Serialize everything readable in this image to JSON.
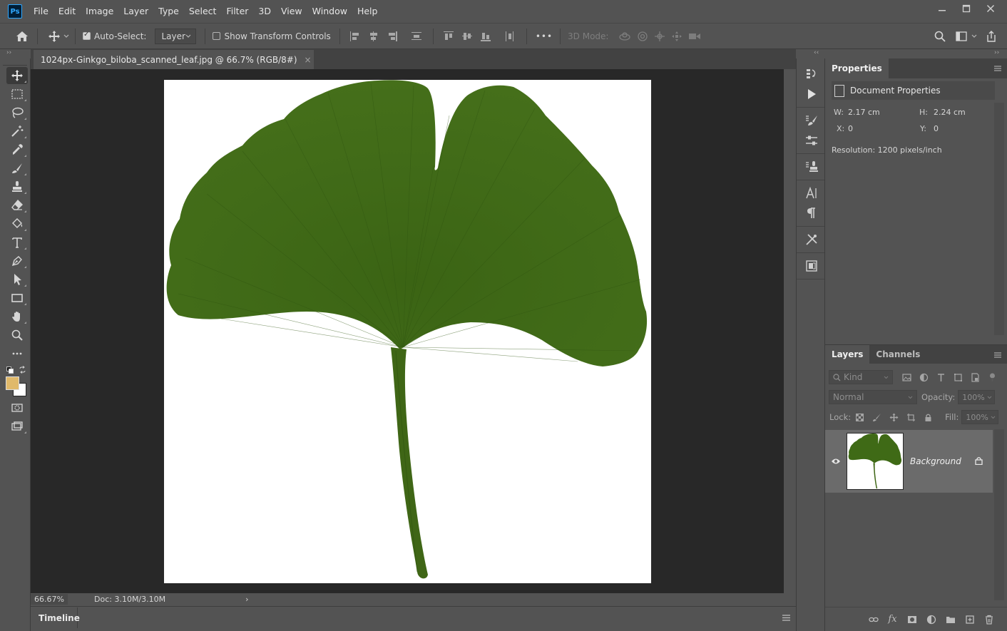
{
  "app": {
    "logo": "Ps"
  },
  "menu": [
    "File",
    "Edit",
    "Image",
    "Layer",
    "Type",
    "Select",
    "Filter",
    "3D",
    "View",
    "Window",
    "Help"
  ],
  "options": {
    "auto_select_label": "Auto-Select:",
    "auto_select_checked": true,
    "layer_select_value": "Layer",
    "show_transform_label": "Show Transform Controls",
    "show_transform_checked": false,
    "more_label": "•••",
    "mode_3d_label": "3D Mode:"
  },
  "document": {
    "tab_title": "1024px-Ginkgo_biloba_scanned_leaf.jpg @ 66.7% (RGB/8#)",
    "close_glyph": "×"
  },
  "status": {
    "zoom": "66.67%",
    "doc_size": "Doc: 3.10M/3.10M",
    "arrow": "›"
  },
  "timeline": {
    "tab_label": "Timeline"
  },
  "properties": {
    "tab_label": "Properties",
    "header": "Document Properties",
    "w_label": "W:",
    "w_value": "2.17 cm",
    "h_label": "H:",
    "h_value": "2.24 cm",
    "x_label": "X:",
    "x_value": "0",
    "y_label": "Y:",
    "y_value": "0",
    "resolution": "Resolution: 1200 pixels/inch"
  },
  "layers": {
    "tabs": [
      "Layers",
      "Channels"
    ],
    "filter_placeholder": "Kind",
    "blend_mode": "Normal",
    "opacity_label": "Opacity:",
    "opacity_value": "100%",
    "lock_label": "Lock:",
    "fill_label": "Fill:",
    "fill_value": "100%",
    "layer_name": "Background"
  },
  "colors": {
    "foreground": "#e0b96a",
    "background": "#ffffff",
    "leaf": "#3f6a16",
    "leaf_dark": "#345b10"
  },
  "icons": {
    "tools": [
      "move-icon",
      "marquee-icon",
      "lasso-icon",
      "magic-wand-icon",
      "eyedropper-icon",
      "brush-icon",
      "stamp-icon",
      "eraser-icon",
      "paint-bucket-icon",
      "type-icon",
      "pen-icon",
      "path-select-icon",
      "rectangle-icon",
      "hand-icon",
      "zoom-icon",
      "more-tools-icon"
    ]
  }
}
